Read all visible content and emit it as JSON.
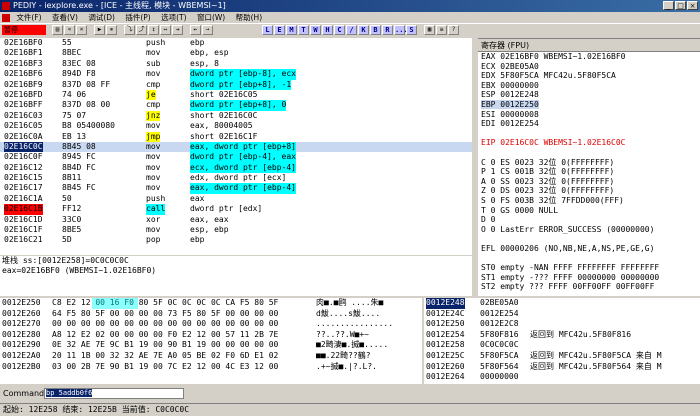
{
  "window": {
    "title": "PEDIY - iexplore.exe - [ICE - 主线程, 模块 - WBEMSI~1]"
  },
  "menu": [
    "文件(F)",
    "查看(V)",
    "调试(D)",
    "插件(P)",
    "选项(T)",
    "窗口(W)",
    "帮助(H)"
  ],
  "toolbar": {
    "status": "暂停",
    "buttons": [
      "▶",
      "⏸",
      "⤵",
      "⤴",
      "↧",
      "↦",
      "⇥",
      "⇤",
      "→"
    ],
    "letters": [
      "L",
      "E",
      "M",
      "T",
      "W",
      "H",
      "C",
      "/",
      "K",
      "B",
      "R",
      "...",
      "S"
    ]
  },
  "disasm": [
    {
      "addr": "02E16BF0",
      "hex": "55",
      "mn": "push",
      "op": "ebp"
    },
    {
      "addr": "02E16BF1",
      "hex": "8BEC",
      "mn": "mov",
      "op": "ebp, esp"
    },
    {
      "addr": "02E16BF3",
      "hex": "83EC 08",
      "mn": "sub",
      "op": "esp, 8"
    },
    {
      "addr": "02E16BF6",
      "hex": "894D F8",
      "mn": "mov",
      "op": "dword ptr [ebp-8], ecx"
    },
    {
      "addr": "02E16BF9",
      "hex": "837D 08 FF",
      "mn": "cmp",
      "op": "dword ptr [ebp+8], -1"
    },
    {
      "addr": "02E16BFD",
      "hex": "74 06",
      "mn": "je",
      "op": "short 02E16C05"
    },
    {
      "addr": "02E16BFF",
      "hex": "837D 08 00",
      "mn": "cmp",
      "op": "dword ptr [ebp+8], 0"
    },
    {
      "addr": "02E16C03",
      "hex": "75 07",
      "mn": "jnz",
      "op": "short 02E16C0C"
    },
    {
      "addr": "02E16C05",
      "hex": "B8 05400080",
      "mn": "mov",
      "op": "eax, 80004005"
    },
    {
      "addr": "02E16C0A",
      "hex": "EB 13",
      "mn": "jmp",
      "op": "short 02E16C1F"
    },
    {
      "addr": "02E16C0C",
      "hex": "8B45 08",
      "mn": "mov",
      "op": "eax, dword ptr [ebp+8]"
    },
    {
      "addr": "02E16C0F",
      "hex": "8945 FC",
      "mn": "mov",
      "op": "dword ptr [ebp-4], eax"
    },
    {
      "addr": "02E16C12",
      "hex": "8B4D FC",
      "mn": "mov",
      "op": "ecx, dword ptr [ebp-4]"
    },
    {
      "addr": "02E16C15",
      "hex": "8B11",
      "mn": "mov",
      "op": "edx, dword ptr [ecx]"
    },
    {
      "addr": "02E16C17",
      "hex": "8B45 FC",
      "mn": "mov",
      "op": "eax, dword ptr [ebp-4]"
    },
    {
      "addr": "02E16C1A",
      "hex": "50",
      "mn": "push",
      "op": "eax"
    },
    {
      "addr": "02E16C1B",
      "hex": "FF12",
      "mn": "call",
      "op": "dword ptr [edx]"
    },
    {
      "addr": "02E16C1D",
      "hex": "33C0",
      "mn": "xor",
      "op": "eax, eax"
    },
    {
      "addr": "02E16C1F",
      "hex": "8BE5",
      "mn": "mov",
      "op": "esp, ebp"
    },
    {
      "addr": "02E16C21",
      "hex": "5D",
      "mn": "pop",
      "op": "ebp"
    }
  ],
  "info": {
    "line1": "堆栈 ss:[0012E258]=0C0C0C0C",
    "line2": "eax=02E16BF0 (WBEMSI~1.02E16BF0)"
  },
  "registers": {
    "header": "寄存器 (FPU)",
    "lines": [
      "EAX 02E16BF0 WBEMSI~1.02E16BF0",
      "ECX 02BE05A0",
      "EDX 5F80F5CA MFC42u.5F80F5CA",
      "EBX 00000000",
      "ESP 0012E248",
      "EBP 0012E250",
      "ESI 00000008",
      "EDI 0012E254",
      "",
      "EIP 02E16C0C WBEMSI~1.02E16C0C",
      "",
      "C 0  ES 0023 32位 0(FFFFFFFF)",
      "P 1  CS 001B 32位 0(FFFFFFFF)",
      "A 0  SS 0023 32位 0(FFFFFFFF)",
      "Z 0  DS 0023 32位 0(FFFFFFFF)",
      "S 0  FS 003B 32位 7FFDD000(FFF)",
      "T 0  GS 0000 NULL",
      "D 0",
      "O 0  LastErr ERROR_SUCCESS (00000000)",
      "",
      "EFL 00000206 (NO,NB,NE,A,NS,PE,GE,G)",
      "",
      "ST0 empty -NAN FFFF FFFFFFFF FFFFFFFF",
      "ST1 empty -??? FFFF 00000000 00000000",
      "ST2 empty ??? FFFF 00FF00FF 00FF00FF"
    ]
  },
  "dump": [
    {
      "addr": "0012E250",
      "hex": "C8 E2 12 00 16 F0 80 5F 0C 0C 0C 0C CA F5 80 5F",
      "asc": "肉■.■鸥 ....朱■"
    },
    {
      "addr": "0012E260",
      "hex": "64 F5 80 5F 00 00 00 00 73 F5 80 5F 00 00 00 00",
      "asc": "d鮁....s鮁...."
    },
    {
      "addr": "0012E270",
      "hex": "00 00 00 00 00 00 00 00 00 00 00 00 00 00 00 00",
      "asc": "................"
    },
    {
      "addr": "0012E280",
      "hex": "A8 12 E2 02 00 00 00 00 F0 E2 12 00 57 11 2B 7E",
      "asc": "??..??.W■+~"
    },
    {
      "addr": "0012E290",
      "hex": "0E 32 AE 7E 9C B1 19 00 90 B1 19 00 00 00 00 00",
      "asc": "■2畸淒■.搣■....."
    },
    {
      "addr": "0012E2A0",
      "hex": "20 11 1B 00 32 32 AE 7E A0 05 BE 02 F0 6D E1 02",
      "asc": " ■■.22畸??鶴?"
    },
    {
      "addr": "0012E2B0",
      "hex": "03 00 2B 7E 90 B1 19 00 7C E2 12 00 4C E3 12 00",
      "asc": ".+~搣■.|?.L?."
    }
  ],
  "stack": [
    {
      "addr": "0012E248",
      "val": "02BE05A0",
      "comment": ""
    },
    {
      "addr": "0012E24C",
      "val": "0012E254",
      "comment": ""
    },
    {
      "addr": "0012E250",
      "val": "0012E2C8",
      "comment": ""
    },
    {
      "addr": "0012E254",
      "val": "5F80F816",
      "comment": "返回到 MFC42u.5F80F816"
    },
    {
      "addr": "0012E258",
      "val": "0C0C0C0C",
      "comment": ""
    },
    {
      "addr": "0012E25C",
      "val": "5F80F5CA",
      "comment": "返回到 MFC42u.5F80F5CA 来自 M"
    },
    {
      "addr": "0012E260",
      "val": "5F80F564",
      "comment": "返回到 MFC42u.5F80F564 来自 M"
    },
    {
      "addr": "0012E264",
      "val": "00000000",
      "comment": ""
    }
  ],
  "command": {
    "label": "Command",
    "value": "bp 5addb0f6"
  },
  "statusbar": {
    "text": "起始: 12E258 结束: 12E25B 当前值: C0C0C0C"
  }
}
